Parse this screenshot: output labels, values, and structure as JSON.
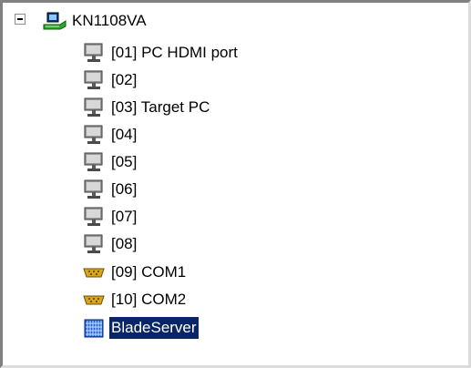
{
  "tree": {
    "root": {
      "label": "KN1108VA",
      "icon": "network-switch-icon",
      "expander": "collapse-minus-icon"
    },
    "items": [
      {
        "label": "[01] PC HDMI port",
        "icon": "monitor-icon"
      },
      {
        "label": "[02]",
        "icon": "monitor-icon"
      },
      {
        "label": "[03] Target PC",
        "icon": "monitor-icon"
      },
      {
        "label": "[04]",
        "icon": "monitor-icon"
      },
      {
        "label": "[05]",
        "icon": "monitor-icon"
      },
      {
        "label": "[06]",
        "icon": "monitor-icon"
      },
      {
        "label": "[07]",
        "icon": "monitor-icon"
      },
      {
        "label": "[08]",
        "icon": "monitor-icon"
      },
      {
        "label": "[09] COM1",
        "icon": "serial-port-icon"
      },
      {
        "label": "[10] COM2",
        "icon": "serial-port-icon"
      },
      {
        "label": "BladeServer",
        "icon": "blade-server-icon",
        "selected": true
      }
    ]
  },
  "colors": {
    "selection_background": "#0a246a",
    "selection_text": "#ffffff",
    "switch_green": "#2ea52e",
    "serial_port_yellow": "#d9a416"
  }
}
